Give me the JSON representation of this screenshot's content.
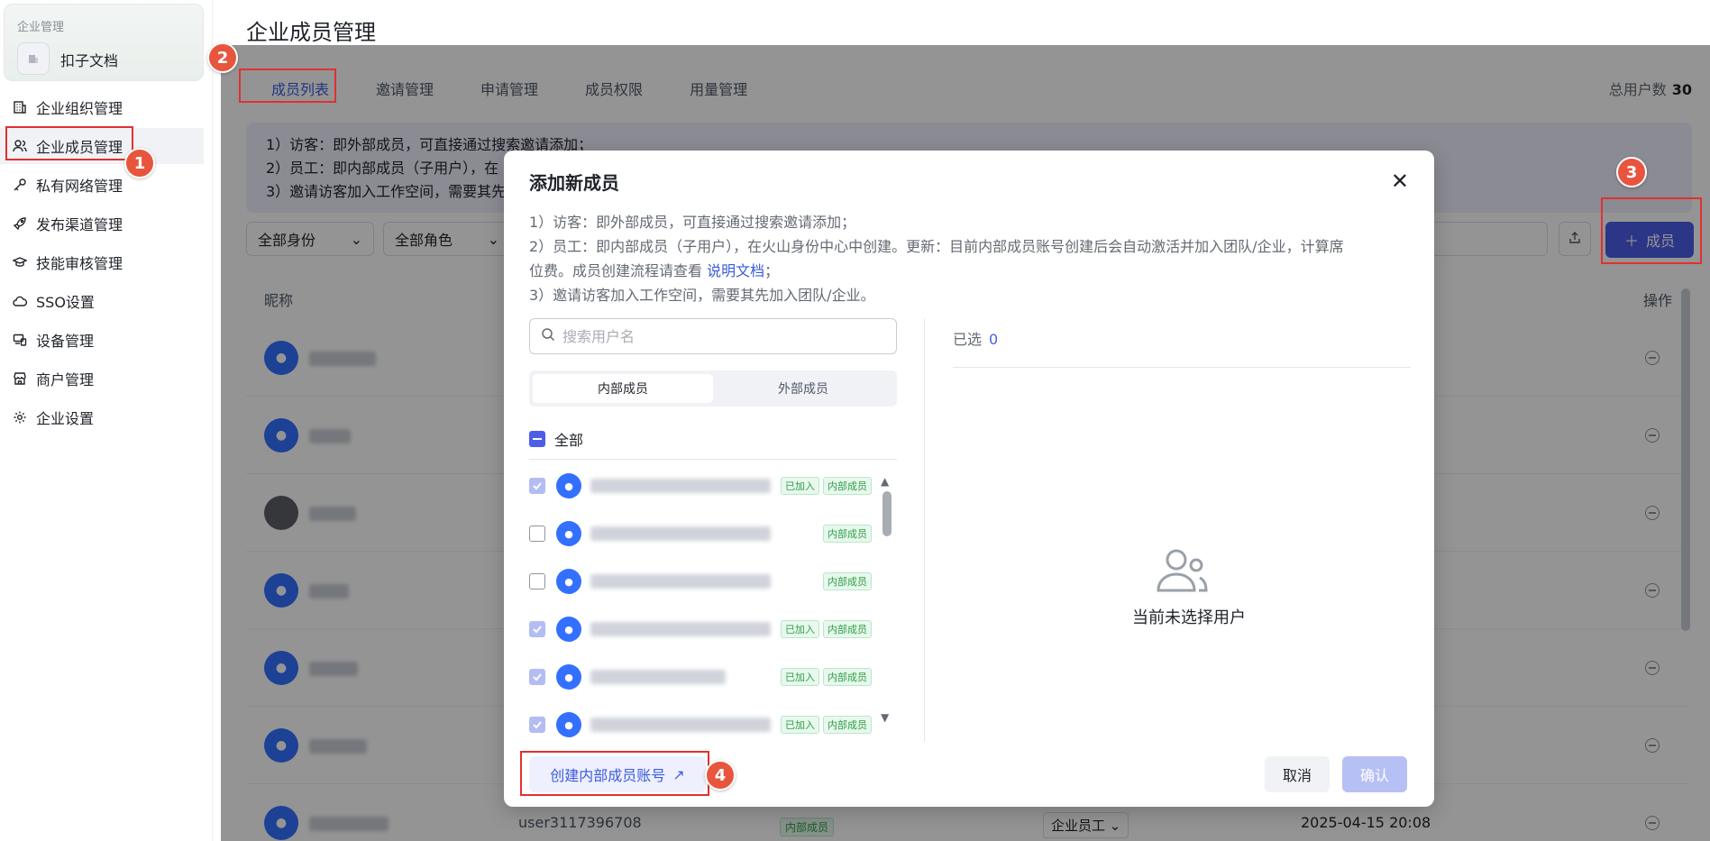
{
  "sidebar": {
    "org_subtitle": "企业管理",
    "org_name": "扣子文档",
    "items": [
      {
        "label": "企业组织管理",
        "icon": "building-icon"
      },
      {
        "label": "企业成员管理",
        "icon": "users-icon",
        "active": true
      },
      {
        "label": "私有网络管理",
        "icon": "key-icon"
      },
      {
        "label": "发布渠道管理",
        "icon": "rocket-icon"
      },
      {
        "label": "技能审核管理",
        "icon": "graduation-cap-icon"
      },
      {
        "label": "SSO设置",
        "icon": "cloud-icon"
      },
      {
        "label": "设备管理",
        "icon": "devices-icon"
      },
      {
        "label": "商户管理",
        "icon": "store-icon"
      },
      {
        "label": "企业设置",
        "icon": "gear-icon"
      }
    ]
  },
  "page": {
    "title": "企业成员管理",
    "tabs": [
      "成员列表",
      "邀请管理",
      "申请管理",
      "成员权限",
      "用量管理"
    ],
    "total_label": "总用户数",
    "total_value": "30",
    "notice": [
      "1）访客：即外部成员，可直接通过搜索邀请添加；",
      "2）员工：即内部成员（子用户），在",
      "3）邀请访客加入工作空间，需要其先"
    ],
    "filter_identity": "全部身份",
    "filter_role": "全部角色",
    "add_button": "成员",
    "col_nickname": "昵称",
    "col_actions": "操作",
    "last_row": {
      "username": "user3117396708",
      "tag": "内部成员",
      "role": "企业员工",
      "time": "2025-04-15 20:08"
    }
  },
  "modal": {
    "title": "添加新成员",
    "desc_line1": "1）访客：即外部成员，可直接通过搜索邀请添加；",
    "desc_line2a": "2）员工：即内部成员（子用户），在火山身份中心中创建。更新：目前内部成员账号创建后会自动激活并加入团队/企业，计算席",
    "desc_line2b": "位费。成员创建流程请查看",
    "desc_link": "说明文档",
    "desc_line2c": "；",
    "desc_line3": "3）邀请访客加入工作空间，需要其先加入团队/企业。",
    "search_placeholder": "搜索用户名",
    "seg_internal": "内部成员",
    "seg_external": "外部成员",
    "select_all": "全部",
    "tag_joined": "已加入",
    "tag_internal": "内部成员",
    "selected_label": "已选",
    "selected_count": "0",
    "empty_text": "当前未选择用户",
    "create_button": "创建内部成员账号",
    "cancel_button": "取消",
    "confirm_button": "确认"
  },
  "annotations": [
    "1",
    "2",
    "3",
    "4"
  ],
  "colors": {
    "accent": "#4d5de8",
    "marker": "#e8553e",
    "highlight": "#e03131"
  }
}
